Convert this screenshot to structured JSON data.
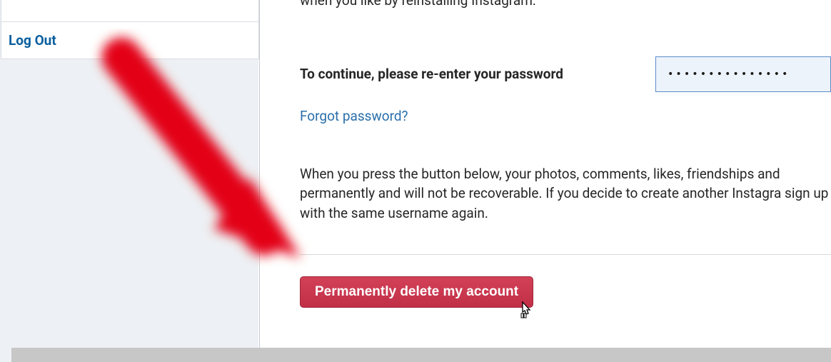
{
  "sidebar": {
    "logout_label": "Log Out"
  },
  "main": {
    "intro_text": "when you like by reinstalling Instagram.",
    "password_label": "To continue, please re-enter your password",
    "password_value": "•••••••••••••••",
    "forgot_label": "Forgot password?",
    "warning_text": "When you press the button below, your photos, comments, likes, friendships and permanently and will not be recoverable. If you decide to create another Instagra sign up with the same username again.",
    "delete_button_label": "Permanently delete my account"
  }
}
